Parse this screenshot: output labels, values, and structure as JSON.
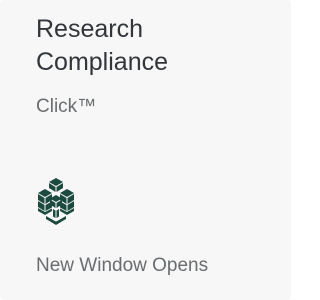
{
  "tile": {
    "title": "Research Compliance",
    "subtitle": "Click™",
    "icon": "cube-cluster-icon",
    "footer": "New Window Opens",
    "icon_color": "#1c4a3f",
    "background_color": "#f7f7f7"
  }
}
